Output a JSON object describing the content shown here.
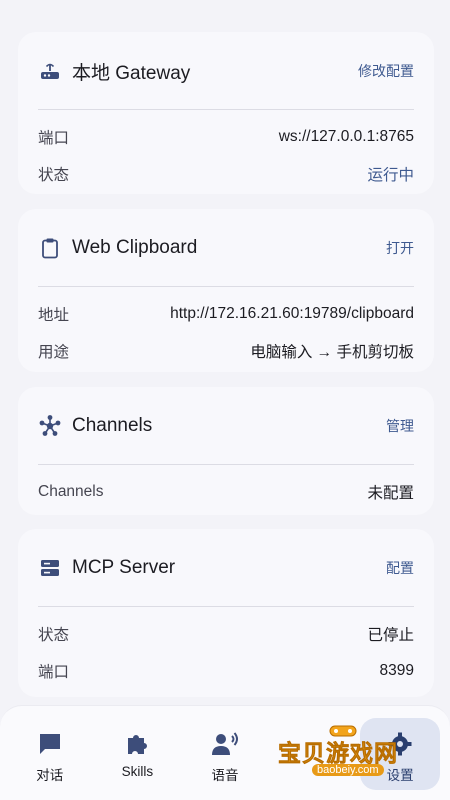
{
  "cards": {
    "gateway": {
      "title": "本地 Gateway",
      "action": "修改配置",
      "rows": [
        {
          "key": "端口",
          "value": "ws://127.0.0.1:8765"
        },
        {
          "key": "状态",
          "value": "运行中"
        }
      ]
    },
    "clipboard": {
      "title": "Web Clipboard",
      "action": "打开",
      "rows": [
        {
          "key": "地址",
          "value": "http://172.16.21.60:19789/clipboard"
        },
        {
          "key": "用途",
          "value": "电脑输入 → 手机剪切板"
        }
      ]
    },
    "channels": {
      "title": "Channels",
      "action": "管理",
      "rows": [
        {
          "key": "Channels",
          "value": "未配置"
        }
      ]
    },
    "mcp": {
      "title": "MCP Server",
      "action": "配置",
      "rows": [
        {
          "key": "状态",
          "value": "已停止"
        },
        {
          "key": "端口",
          "value": "8399"
        }
      ]
    }
  },
  "tabs": [
    {
      "label": "对话",
      "icon": "chat-icon"
    },
    {
      "label": "Skills",
      "icon": "puzzle-icon"
    },
    {
      "label": "语音",
      "icon": "voice-icon"
    },
    {
      "label": "",
      "icon": "hidden-tab-icon"
    },
    {
      "label": "设置",
      "icon": "settings-icon"
    }
  ],
  "watermark": {
    "text": "宝贝游戏网",
    "url": "baobeiy.com"
  },
  "colors": {
    "accent": "#3f5a90",
    "icon": "#3d4d7a",
    "background": "#f3f3f8",
    "card": "#f8f8fc"
  }
}
